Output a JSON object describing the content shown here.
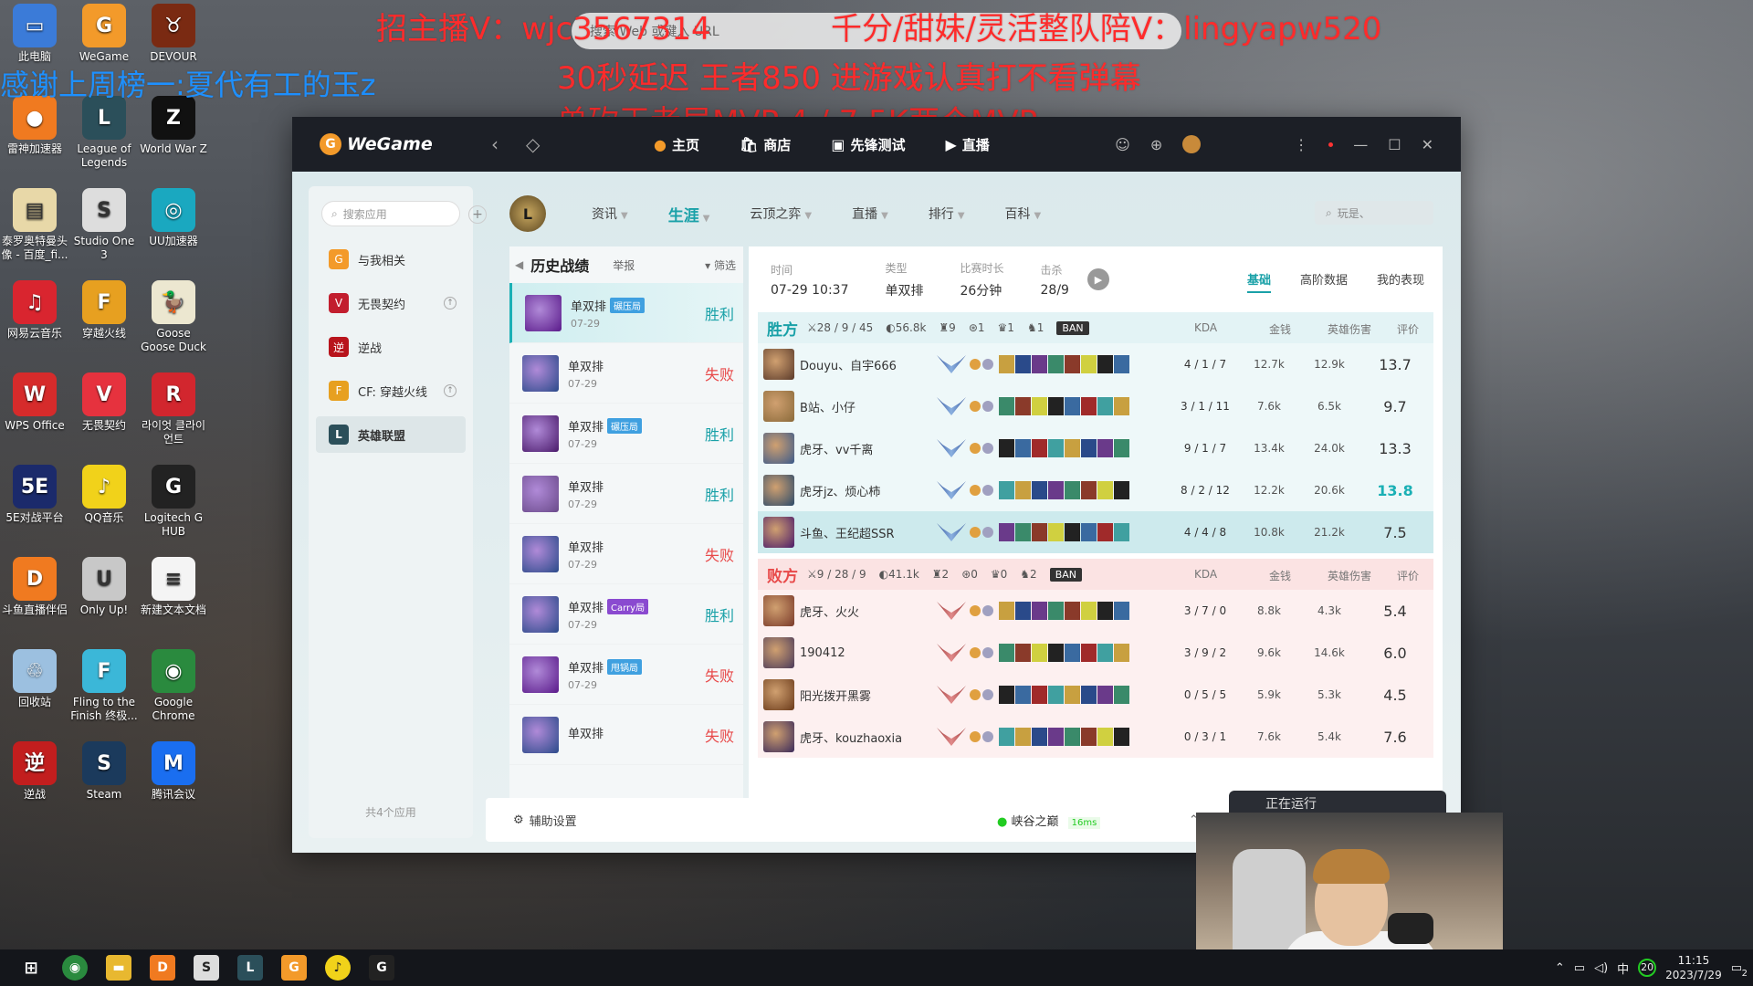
{
  "overlay": {
    "line1_left": "招主播V：wjc3567314",
    "line1_right": "千分/甜妹/灵活整队陪V：lingyapw520",
    "line2": "30秒延迟  王者850  进游戏认真打不看弹幕",
    "line3": "单砍王者局MVP    4 / 7            5K两个MVP",
    "thanks": "感谢上周榜一:夏代有工的玉z",
    "browser_placeholder": "搜索 Web 或键入 URL"
  },
  "desktop_icons": [
    {
      "label": "此电脑",
      "color": "#3b7bd8",
      "glyph": "▭"
    },
    {
      "label": "WeGame",
      "color": "#f39a2a",
      "glyph": "G"
    },
    {
      "label": "DEVOUR",
      "color": "#7a2a12",
      "glyph": "♉"
    },
    {
      "label": "雷神加速器",
      "color": "#f07a20",
      "glyph": "●"
    },
    {
      "label": "League of Legends",
      "color": "#2b4f5a",
      "glyph": "L"
    },
    {
      "label": "World War Z",
      "color": "#111111",
      "glyph": "Z"
    },
    {
      "label": "泰罗奥特曼头像 - 百度_fi...",
      "color": "#e8d8a8",
      "glyph": "▤"
    },
    {
      "label": "Studio One 3",
      "color": "#dddddd",
      "glyph": "S"
    },
    {
      "label": "UU加速器",
      "color": "#1aa8c0",
      "glyph": "◎"
    },
    {
      "label": "网易云音乐",
      "color": "#d9252f",
      "glyph": "♫"
    },
    {
      "label": "穿越火线",
      "color": "#e7a020",
      "glyph": "F"
    },
    {
      "label": "Goose Goose Duck",
      "color": "#ece7d0",
      "glyph": "🦆"
    },
    {
      "label": "WPS Office",
      "color": "#d62b2b",
      "glyph": "W"
    },
    {
      "label": "无畏契约",
      "color": "#e6323e",
      "glyph": "V"
    },
    {
      "label": "라이엇 클라이언트",
      "color": "#d2262e",
      "glyph": "R"
    },
    {
      "label": "5E对战平台",
      "color": "#1b2a6b",
      "glyph": "5E"
    },
    {
      "label": "QQ音乐",
      "color": "#f1d21a",
      "glyph": "♪"
    },
    {
      "label": "Logitech G HUB",
      "color": "#222222",
      "glyph": "G"
    },
    {
      "label": "斗鱼直播伴侣",
      "color": "#f07a20",
      "glyph": "D"
    },
    {
      "label": "Only Up!",
      "color": "#c8c8c8",
      "glyph": "U"
    },
    {
      "label": "新建文本文档",
      "color": "#f4f4f4",
      "glyph": "≡"
    },
    {
      "label": "回收站",
      "color": "#9cc0e0",
      "glyph": "♲"
    },
    {
      "label": "Fling to the Finish 终极...",
      "color": "#3bb7d8",
      "glyph": "F"
    },
    {
      "label": "Google Chrome",
      "color": "#2a8a3e",
      "glyph": "◉"
    },
    {
      "label": "逆战",
      "color": "#c21e1e",
      "glyph": "逆"
    },
    {
      "label": "Steam",
      "color": "#1b3a5c",
      "glyph": "S"
    },
    {
      "label": "腾讯会议",
      "color": "#1a6ef0",
      "glyph": "M"
    }
  ],
  "wegame": {
    "logo": "WeGame",
    "topnav": [
      {
        "label": "主页",
        "icon": "home-icon",
        "glyph": "●"
      },
      {
        "label": "商店",
        "icon": "store-icon",
        "glyph": "🛍"
      },
      {
        "label": "先锋测试",
        "icon": "test-icon",
        "glyph": "▣"
      },
      {
        "label": "直播",
        "icon": "live-icon",
        "glyph": "▶"
      }
    ],
    "sidebar": {
      "search_placeholder": "搜索应用",
      "items": [
        {
          "label": "与我相关",
          "color": "#f39a2a",
          "glyph": "G",
          "badge": ""
        },
        {
          "label": "无畏契约",
          "color": "#c21e2e",
          "glyph": "V",
          "badge": "↑"
        },
        {
          "label": "逆战",
          "color": "#b8141c",
          "glyph": "逆",
          "badge": ""
        },
        {
          "label": "CF: 穿越火线",
          "color": "#e7a020",
          "glyph": "F",
          "badge": "↑"
        },
        {
          "label": "英雄联盟",
          "color": "#2b4f5a",
          "glyph": "L",
          "badge": ""
        }
      ],
      "footer": "共4个应用"
    },
    "game_tabs": [
      {
        "label": "资讯",
        "caret": true,
        "active": false
      },
      {
        "label": "生涯",
        "caret": true,
        "active": true
      },
      {
        "label": "云顶之弈",
        "caret": true,
        "active": false
      },
      {
        "label": "直播",
        "caret": true,
        "active": false
      },
      {
        "label": "排行",
        "caret": true,
        "active": false
      },
      {
        "label": "百科",
        "caret": true,
        "active": false
      }
    ],
    "player_search_placeholder": "玩是、",
    "history": {
      "title": "历史战绩",
      "report": "举报",
      "filter": "筛选",
      "matches": [
        {
          "queue": "单双排",
          "tag": "碾压局",
          "tag_color": "#3fa0e0",
          "date": "07-29",
          "result": "胜利",
          "win": true,
          "color": "#5a1a8a"
        },
        {
          "queue": "单双排",
          "tag": "",
          "tag_color": "",
          "date": "07-29",
          "result": "失败",
          "win": false,
          "color": "#2a4a8a"
        },
        {
          "queue": "单双排",
          "tag": "碾压局",
          "tag_color": "#3fa0e0",
          "date": "07-29",
          "result": "胜利",
          "win": true,
          "color": "#4a1a6a"
        },
        {
          "queue": "单双排",
          "tag": "",
          "tag_color": "",
          "date": "07-29",
          "result": "胜利",
          "win": true,
          "color": "#6a4a8a"
        },
        {
          "queue": "单双排",
          "tag": "",
          "tag_color": "",
          "date": "07-29",
          "result": "失败",
          "win": false,
          "color": "#2a4a8a"
        },
        {
          "queue": "单双排",
          "tag": "Carry局",
          "tag_color": "#8a4ad0",
          "date": "07-29",
          "result": "胜利",
          "win": true,
          "color": "#2a4a8a"
        },
        {
          "queue": "单双排",
          "tag": "甩锅局",
          "tag_color": "#3fa0e0",
          "date": "07-29",
          "result": "失败",
          "win": false,
          "color": "#5a1a8a"
        },
        {
          "queue": "单双排",
          "tag": "",
          "tag_color": "",
          "date": "",
          "result": "失败",
          "win": false,
          "color": "#2a4a8a"
        }
      ],
      "page": "1"
    },
    "detail": {
      "labels": {
        "time": "时间",
        "type": "类型",
        "duration": "比赛时长",
        "kills": "击杀"
      },
      "values": {
        "time": "07-29 10:37",
        "type": "单双排",
        "duration": "26分钟",
        "kills": "28/9"
      },
      "tabs": [
        "基础",
        "高阶数据",
        "我的表现"
      ],
      "columns": {
        "kda": "KDA",
        "gold": "金钱",
        "damage": "英雄伤害",
        "score": "评价"
      },
      "win_team": {
        "name": "胜方",
        "stats": [
          "⚔28 / 9 / 45",
          "◐56.8k",
          "♜9",
          "⊛1",
          "♛1",
          "♞1"
        ],
        "ban": "BAN",
        "players": [
          {
            "name": "Douyu、自宇666",
            "kda": "4 / 1 / 7",
            "gold": "12.7k",
            "damage": "12.9k",
            "score": "13.7",
            "color": "#5a3a2a",
            "hl": false,
            "teal_score": false
          },
          {
            "name": "B站、小仔",
            "kda": "3 / 1 / 11",
            "gold": "7.6k",
            "damage": "6.5k",
            "score": "9.7",
            "color": "#8a6a3a",
            "hl": false,
            "teal_score": false
          },
          {
            "name": "虎牙、vv千离",
            "kda": "9 / 1 / 7",
            "gold": "13.4k",
            "damage": "24.0k",
            "score": "13.3",
            "color": "#3a5a8a",
            "hl": false,
            "teal_score": false
          },
          {
            "name": "虎牙jz、烦心柿",
            "kda": "8 / 2 / 12",
            "gold": "12.2k",
            "damage": "20.6k",
            "score": "13.8",
            "color": "#2a4a6a",
            "hl": false,
            "teal_score": true
          },
          {
            "name": "斗鱼、王纪超SSR",
            "kda": "4 / 4 / 8",
            "gold": "10.8k",
            "damage": "21.2k",
            "score": "7.5",
            "color": "#4a1a6a",
            "hl": true,
            "teal_score": false
          }
        ]
      },
      "loss_team": {
        "name": "败方",
        "stats": [
          "⚔9 / 28 / 9",
          "◐41.1k",
          "♜2",
          "⊛0",
          "♛0",
          "♞2"
        ],
        "ban": "BAN",
        "players": [
          {
            "name": "虎牙、火火",
            "kda": "3 / 7 / 0",
            "gold": "8.8k",
            "damage": "4.3k",
            "score": "5.4",
            "color": "#7a3a2a"
          },
          {
            "name": "190412",
            "kda": "3 / 9 / 2",
            "gold": "9.6k",
            "damage": "14.6k",
            "score": "6.0",
            "color": "#4a3a5a"
          },
          {
            "name": "阳光拨开黑雾",
            "kda": "0 / 5 / 5",
            "gold": "5.9k",
            "damage": "5.3k",
            "score": "4.5",
            "color": "#6a3a1a"
          },
          {
            "name": "虎牙、kouzhaoxia",
            "kda": "0 / 3 / 1",
            "gold": "7.6k",
            "damage": "5.4k",
            "score": "7.6",
            "color": "#3a2a5a"
          }
        ]
      }
    },
    "bottom": {
      "settings": "辅助设置",
      "server": "峡谷之巅",
      "ping": "16ms",
      "running": "正在运行"
    }
  },
  "taskbar": {
    "time": "11:15",
    "date": "2023/7/29",
    "ime": "中",
    "notif": "2",
    "badge": "20"
  }
}
